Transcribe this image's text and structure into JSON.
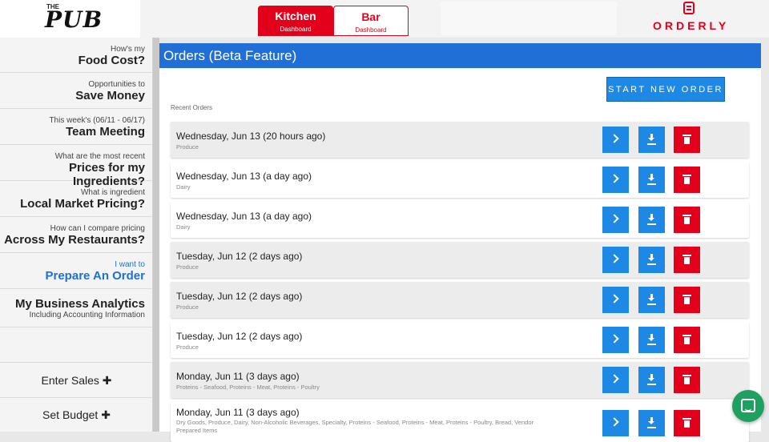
{
  "header": {
    "logo_small": "THE",
    "logo_big": "PUB",
    "tabs": [
      {
        "title": "Kitchen",
        "subtitle": "Dashboard"
      },
      {
        "title": "Bar",
        "subtitle": "Dashboard"
      }
    ],
    "brand": "ORDERLY"
  },
  "sidebar": {
    "items": [
      {
        "small": "How's my",
        "big": "Food Cost?"
      },
      {
        "small": "Opportunities to",
        "big": "Save Money"
      },
      {
        "small": "This week's (06/11 - 06/17)",
        "big": "Team Meeting"
      },
      {
        "small": "What are the most recent",
        "big": "Prices for my Ingredients?"
      },
      {
        "small": "What is ingredient",
        "big": "Local Market Pricing?"
      },
      {
        "small": "How can I compare pricing",
        "big": "Across My Restaurants?"
      },
      {
        "small": "I want to",
        "big": "Prepare An Order"
      }
    ],
    "analytics": {
      "big": "My Business Analytics",
      "small": "Including Accounting Information"
    },
    "enter_sales": "Enter Sales ✚",
    "set_budget": "Set Budget ✚"
  },
  "main": {
    "title": "Orders (Beta Feature)",
    "start_button": "START NEW ORDER",
    "recent_label": "Recent Orders",
    "orders": [
      {
        "date": "Wednesday, Jun 13 (20 hours ago)",
        "categories": "Produce"
      },
      {
        "date": "Wednesday, Jun 13 (a day ago)",
        "categories": "Dairy"
      },
      {
        "date": "Wednesday, Jun 13 (a day ago)",
        "categories": "Dairy"
      },
      {
        "date": "Tuesday, Jun 12 (2 days ago)",
        "categories": "Produce"
      },
      {
        "date": "Tuesday, Jun 12 (2 days ago)",
        "categories": "Produce"
      },
      {
        "date": "Tuesday, Jun 12 (2 days ago)",
        "categories": "Produce"
      },
      {
        "date": "Monday, Jun 11 (3 days ago)",
        "categories": "Proteins - Seafood, Proteins - Meat, Proteins - Poultry"
      },
      {
        "date": "Monday, Jun 11 (3 days ago)",
        "categories": "Dry Goods, Produce, Dairy, Non-Alcoholic Beverages, Specialty, Proteins - Seafood, Proteins - Meat, Proteins - Poultry, Bread, Vendor",
        "categories_line2": "Prepared Items"
      }
    ]
  },
  "colors": {
    "brand_red": "#e2001a",
    "primary_blue": "#1f6fd6",
    "button_blue": "#1e88e5",
    "chat_green": "#1ea060"
  }
}
